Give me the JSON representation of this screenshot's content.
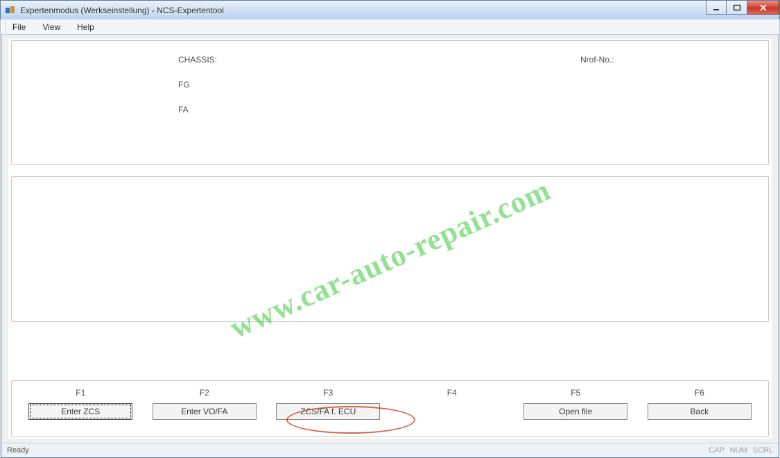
{
  "window": {
    "title": "Expertenmodus (Werkseinstellung) - NCS-Expertentool"
  },
  "menu": {
    "file": "File",
    "view": "View",
    "help": "Help"
  },
  "info": {
    "chassis_label": "CHASSIS:",
    "fg_label": "FG",
    "fa_label": "FA",
    "nrofno_label": "Nrof-No.:"
  },
  "fkeys": {
    "f1": "F1",
    "f2": "F2",
    "f3": "F3",
    "f4": "F4",
    "f5": "F5",
    "f6": "F6"
  },
  "buttons": {
    "b1": "Enter ZCS",
    "b2": "Enter VO/FA",
    "b3": "ZCS/FA f. ECU",
    "b4": "",
    "b5": "Open file",
    "b6": "Back"
  },
  "status": {
    "left": "Ready",
    "cap": "CAP",
    "num": "NUM",
    "scrl": "SCRL"
  },
  "watermark": "www.car-auto-repair.com"
}
